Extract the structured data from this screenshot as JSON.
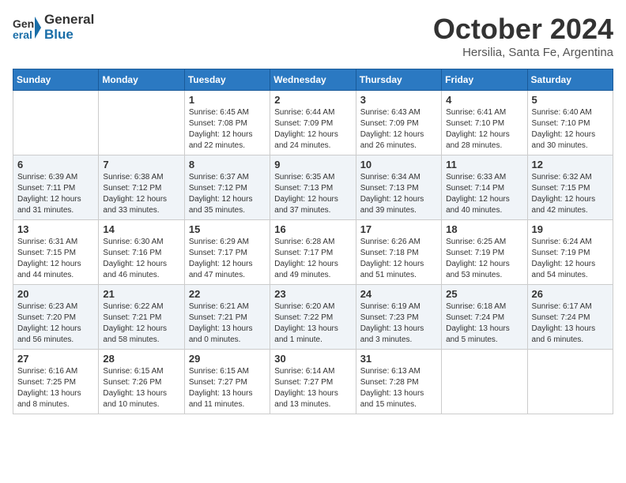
{
  "header": {
    "logo_line1": "General",
    "logo_line2": "Blue",
    "month": "October 2024",
    "location": "Hersilia, Santa Fe, Argentina"
  },
  "days_of_week": [
    "Sunday",
    "Monday",
    "Tuesday",
    "Wednesday",
    "Thursday",
    "Friday",
    "Saturday"
  ],
  "weeks": [
    [
      {
        "day": "",
        "sunrise": "",
        "sunset": "",
        "daylight": ""
      },
      {
        "day": "",
        "sunrise": "",
        "sunset": "",
        "daylight": ""
      },
      {
        "day": "1",
        "sunrise": "Sunrise: 6:45 AM",
        "sunset": "Sunset: 7:08 PM",
        "daylight": "Daylight: 12 hours and 22 minutes."
      },
      {
        "day": "2",
        "sunrise": "Sunrise: 6:44 AM",
        "sunset": "Sunset: 7:09 PM",
        "daylight": "Daylight: 12 hours and 24 minutes."
      },
      {
        "day": "3",
        "sunrise": "Sunrise: 6:43 AM",
        "sunset": "Sunset: 7:09 PM",
        "daylight": "Daylight: 12 hours and 26 minutes."
      },
      {
        "day": "4",
        "sunrise": "Sunrise: 6:41 AM",
        "sunset": "Sunset: 7:10 PM",
        "daylight": "Daylight: 12 hours and 28 minutes."
      },
      {
        "day": "5",
        "sunrise": "Sunrise: 6:40 AM",
        "sunset": "Sunset: 7:10 PM",
        "daylight": "Daylight: 12 hours and 30 minutes."
      }
    ],
    [
      {
        "day": "6",
        "sunrise": "Sunrise: 6:39 AM",
        "sunset": "Sunset: 7:11 PM",
        "daylight": "Daylight: 12 hours and 31 minutes."
      },
      {
        "day": "7",
        "sunrise": "Sunrise: 6:38 AM",
        "sunset": "Sunset: 7:12 PM",
        "daylight": "Daylight: 12 hours and 33 minutes."
      },
      {
        "day": "8",
        "sunrise": "Sunrise: 6:37 AM",
        "sunset": "Sunset: 7:12 PM",
        "daylight": "Daylight: 12 hours and 35 minutes."
      },
      {
        "day": "9",
        "sunrise": "Sunrise: 6:35 AM",
        "sunset": "Sunset: 7:13 PM",
        "daylight": "Daylight: 12 hours and 37 minutes."
      },
      {
        "day": "10",
        "sunrise": "Sunrise: 6:34 AM",
        "sunset": "Sunset: 7:13 PM",
        "daylight": "Daylight: 12 hours and 39 minutes."
      },
      {
        "day": "11",
        "sunrise": "Sunrise: 6:33 AM",
        "sunset": "Sunset: 7:14 PM",
        "daylight": "Daylight: 12 hours and 40 minutes."
      },
      {
        "day": "12",
        "sunrise": "Sunrise: 6:32 AM",
        "sunset": "Sunset: 7:15 PM",
        "daylight": "Daylight: 12 hours and 42 minutes."
      }
    ],
    [
      {
        "day": "13",
        "sunrise": "Sunrise: 6:31 AM",
        "sunset": "Sunset: 7:15 PM",
        "daylight": "Daylight: 12 hours and 44 minutes."
      },
      {
        "day": "14",
        "sunrise": "Sunrise: 6:30 AM",
        "sunset": "Sunset: 7:16 PM",
        "daylight": "Daylight: 12 hours and 46 minutes."
      },
      {
        "day": "15",
        "sunrise": "Sunrise: 6:29 AM",
        "sunset": "Sunset: 7:17 PM",
        "daylight": "Daylight: 12 hours and 47 minutes."
      },
      {
        "day": "16",
        "sunrise": "Sunrise: 6:28 AM",
        "sunset": "Sunset: 7:17 PM",
        "daylight": "Daylight: 12 hours and 49 minutes."
      },
      {
        "day": "17",
        "sunrise": "Sunrise: 6:26 AM",
        "sunset": "Sunset: 7:18 PM",
        "daylight": "Daylight: 12 hours and 51 minutes."
      },
      {
        "day": "18",
        "sunrise": "Sunrise: 6:25 AM",
        "sunset": "Sunset: 7:19 PM",
        "daylight": "Daylight: 12 hours and 53 minutes."
      },
      {
        "day": "19",
        "sunrise": "Sunrise: 6:24 AM",
        "sunset": "Sunset: 7:19 PM",
        "daylight": "Daylight: 12 hours and 54 minutes."
      }
    ],
    [
      {
        "day": "20",
        "sunrise": "Sunrise: 6:23 AM",
        "sunset": "Sunset: 7:20 PM",
        "daylight": "Daylight: 12 hours and 56 minutes."
      },
      {
        "day": "21",
        "sunrise": "Sunrise: 6:22 AM",
        "sunset": "Sunset: 7:21 PM",
        "daylight": "Daylight: 12 hours and 58 minutes."
      },
      {
        "day": "22",
        "sunrise": "Sunrise: 6:21 AM",
        "sunset": "Sunset: 7:21 PM",
        "daylight": "Daylight: 13 hours and 0 minutes."
      },
      {
        "day": "23",
        "sunrise": "Sunrise: 6:20 AM",
        "sunset": "Sunset: 7:22 PM",
        "daylight": "Daylight: 13 hours and 1 minute."
      },
      {
        "day": "24",
        "sunrise": "Sunrise: 6:19 AM",
        "sunset": "Sunset: 7:23 PM",
        "daylight": "Daylight: 13 hours and 3 minutes."
      },
      {
        "day": "25",
        "sunrise": "Sunrise: 6:18 AM",
        "sunset": "Sunset: 7:24 PM",
        "daylight": "Daylight: 13 hours and 5 minutes."
      },
      {
        "day": "26",
        "sunrise": "Sunrise: 6:17 AM",
        "sunset": "Sunset: 7:24 PM",
        "daylight": "Daylight: 13 hours and 6 minutes."
      }
    ],
    [
      {
        "day": "27",
        "sunrise": "Sunrise: 6:16 AM",
        "sunset": "Sunset: 7:25 PM",
        "daylight": "Daylight: 13 hours and 8 minutes."
      },
      {
        "day": "28",
        "sunrise": "Sunrise: 6:15 AM",
        "sunset": "Sunset: 7:26 PM",
        "daylight": "Daylight: 13 hours and 10 minutes."
      },
      {
        "day": "29",
        "sunrise": "Sunrise: 6:15 AM",
        "sunset": "Sunset: 7:27 PM",
        "daylight": "Daylight: 13 hours and 11 minutes."
      },
      {
        "day": "30",
        "sunrise": "Sunrise: 6:14 AM",
        "sunset": "Sunset: 7:27 PM",
        "daylight": "Daylight: 13 hours and 13 minutes."
      },
      {
        "day": "31",
        "sunrise": "Sunrise: 6:13 AM",
        "sunset": "Sunset: 7:28 PM",
        "daylight": "Daylight: 13 hours and 15 minutes."
      },
      {
        "day": "",
        "sunrise": "",
        "sunset": "",
        "daylight": ""
      },
      {
        "day": "",
        "sunrise": "",
        "sunset": "",
        "daylight": ""
      }
    ]
  ]
}
